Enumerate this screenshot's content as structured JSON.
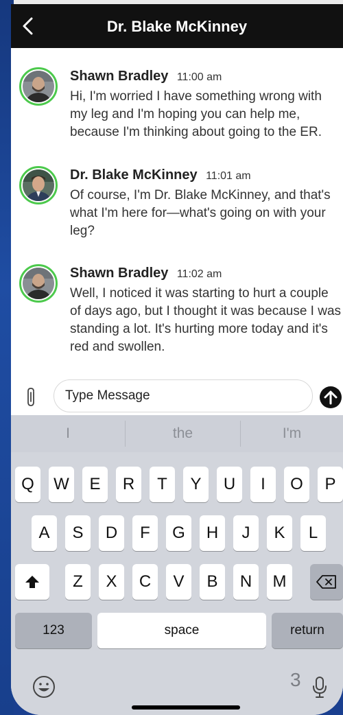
{
  "header": {
    "title": "Dr. Blake McKinney"
  },
  "messages": [
    {
      "sender": "Shawn Bradley",
      "time": "11:00 am",
      "text": "Hi, I'm worried I have something wrong with my leg and I'm hoping you can help me, because I'm thinking about going to the ER."
    },
    {
      "sender": "Dr. Blake McKinney",
      "time": "11:01 am",
      "text": "Of course, I'm Dr. Blake McKinney, and that's what I'm here for—what's going on with your leg?"
    },
    {
      "sender": "Shawn Bradley",
      "time": "11:02 am",
      "text": "Well, I noticed it was starting to hurt a couple of days ago, but I thought it was because I was standing a lot. It's hurting more today and it's red and swollen."
    }
  ],
  "composer": {
    "placeholder": "Type Message"
  },
  "keyboard": {
    "suggestions": [
      "I",
      "the",
      "I'm"
    ],
    "row1": [
      "Q",
      "W",
      "E",
      "R",
      "T",
      "Y",
      "U",
      "I",
      "O",
      "P"
    ],
    "row2": [
      "A",
      "S",
      "D",
      "F",
      "G",
      "H",
      "J",
      "K",
      "L"
    ],
    "row3": [
      "Z",
      "X",
      "C",
      "V",
      "B",
      "N",
      "M"
    ],
    "numbers_key": "123",
    "space_key": "space",
    "return_key": "return",
    "number_hint": "3"
  },
  "icons": {
    "back": "chevron-left-icon",
    "attach": "paperclip-icon",
    "send": "arrow-up-circle-icon",
    "shift": "shift-icon",
    "delete": "backspace-icon",
    "emoji": "emoji-icon",
    "mic": "microphone-icon"
  },
  "colors": {
    "header_bg": "#111111",
    "avatar_ring": "#4cc94c",
    "keyboard_bg": "#d2d5dc",
    "background": "#1a3f8f"
  }
}
